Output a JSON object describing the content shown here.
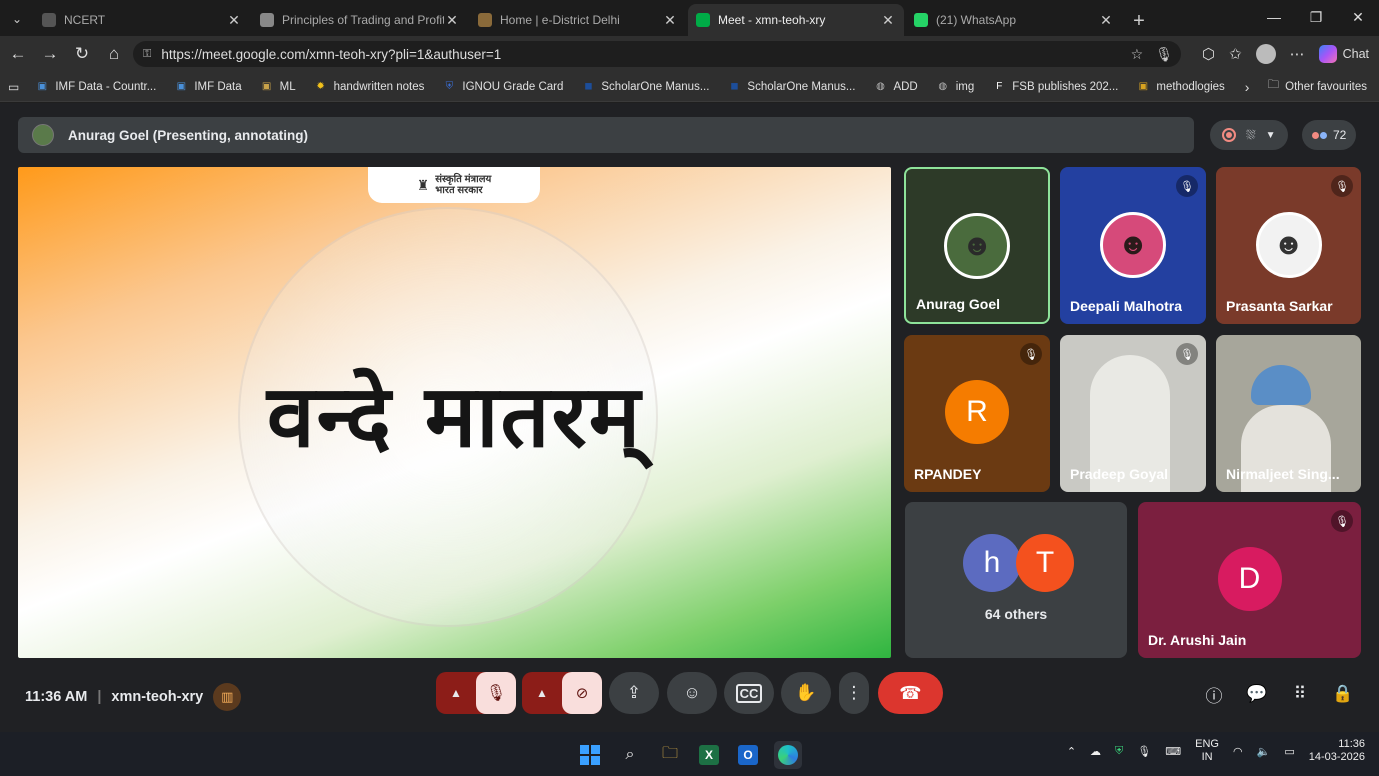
{
  "browser": {
    "tabs": [
      {
        "title": "NCERT",
        "favicon_color": "#555555",
        "active": false
      },
      {
        "title": "Principles of Trading and Profit an",
        "favicon_color": "#888888",
        "active": false
      },
      {
        "title": "Home | e-District Delhi",
        "favicon_color": "#8a6a3a",
        "active": false
      },
      {
        "title": "Meet - xmn-teoh-xry",
        "favicon_color": "#00ac47",
        "active": true
      },
      {
        "title": "(21) WhatsApp",
        "favicon_color": "#25d366",
        "active": false
      }
    ],
    "url": "https://meet.google.com/xmn-teoh-xry?pli=1&authuser=1",
    "chat_label": "Chat",
    "bookmarks": [
      {
        "label": "IMF Data - Countr...",
        "icon": "image-icon",
        "color": "#4a90d9"
      },
      {
        "label": "IMF Data",
        "icon": "image-icon",
        "color": "#4a90d9"
      },
      {
        "label": "ML",
        "icon": "image-icon",
        "color": "#c9a34a"
      },
      {
        "label": "handwritten notes",
        "icon": "sun-icon",
        "color": "#f2c11b"
      },
      {
        "label": "IGNOU Grade Card",
        "icon": "shield-icon",
        "color": "#3b6fd8"
      },
      {
        "label": "ScholarOne Manus...",
        "icon": "s1-icon",
        "color": "#1d4e9a"
      },
      {
        "label": "ScholarOne Manus...",
        "icon": "s1-icon",
        "color": "#1d4e9a"
      },
      {
        "label": "ADD",
        "icon": "globe-icon",
        "color": "#bbbbbb"
      },
      {
        "label": "img",
        "icon": "globe-icon",
        "color": "#bbbbbb"
      },
      {
        "label": "FSB publishes 202...",
        "icon": "fsb-icon",
        "color": "#ffffff"
      },
      {
        "label": "methodlogies",
        "icon": "image-icon",
        "color": "#d8a320"
      }
    ],
    "other_favourites": "Other favourites"
  },
  "meet": {
    "presenter_banner": "Anurag Goel (Presenting, annotating)",
    "participant_count": "72",
    "slide": {
      "ministry_line1": "संस्कृति मंत्रालय",
      "ministry_line2": "भारत सरकार",
      "headline": "वन्दे मातरम्"
    },
    "participants": [
      {
        "name": "Anurag Goel",
        "bg": "#2d3a28",
        "muted": false,
        "type": "photo"
      },
      {
        "name": "Deepali Malhotra",
        "bg": "#2340a0",
        "muted": true,
        "type": "photo"
      },
      {
        "name": "Prasanta Sarkar",
        "bg": "#7a3a2a",
        "muted": true,
        "type": "photo"
      },
      {
        "name": "RPANDEY",
        "bg": "#6b3a12",
        "muted": true,
        "type": "letter",
        "letter": "R",
        "letter_color": "#f57c00"
      },
      {
        "name": "Pradeep Goyal",
        "bg": "#c9c9c4",
        "muted": true,
        "type": "video"
      },
      {
        "name": "Nirmaljeet Sing...",
        "bg": "#a7a69b",
        "muted": false,
        "type": "video"
      },
      {
        "name": "Dr. Arushi Jain",
        "bg": "#7b1f3f",
        "muted": true,
        "type": "letter",
        "letter": "D",
        "letter_color": "#d81b60"
      }
    ],
    "others": {
      "label": "64 others",
      "avatars": [
        {
          "letter": "h",
          "color": "#5c6bc0"
        },
        {
          "letter": "T",
          "color": "#f4511e"
        }
      ]
    },
    "time": "11:36 AM",
    "meeting_code": "xmn-teoh-xry"
  },
  "taskbar": {
    "lang_line1": "ENG",
    "lang_line2": "IN",
    "clock_time": "11:36",
    "clock_date": "14-03-2026"
  }
}
